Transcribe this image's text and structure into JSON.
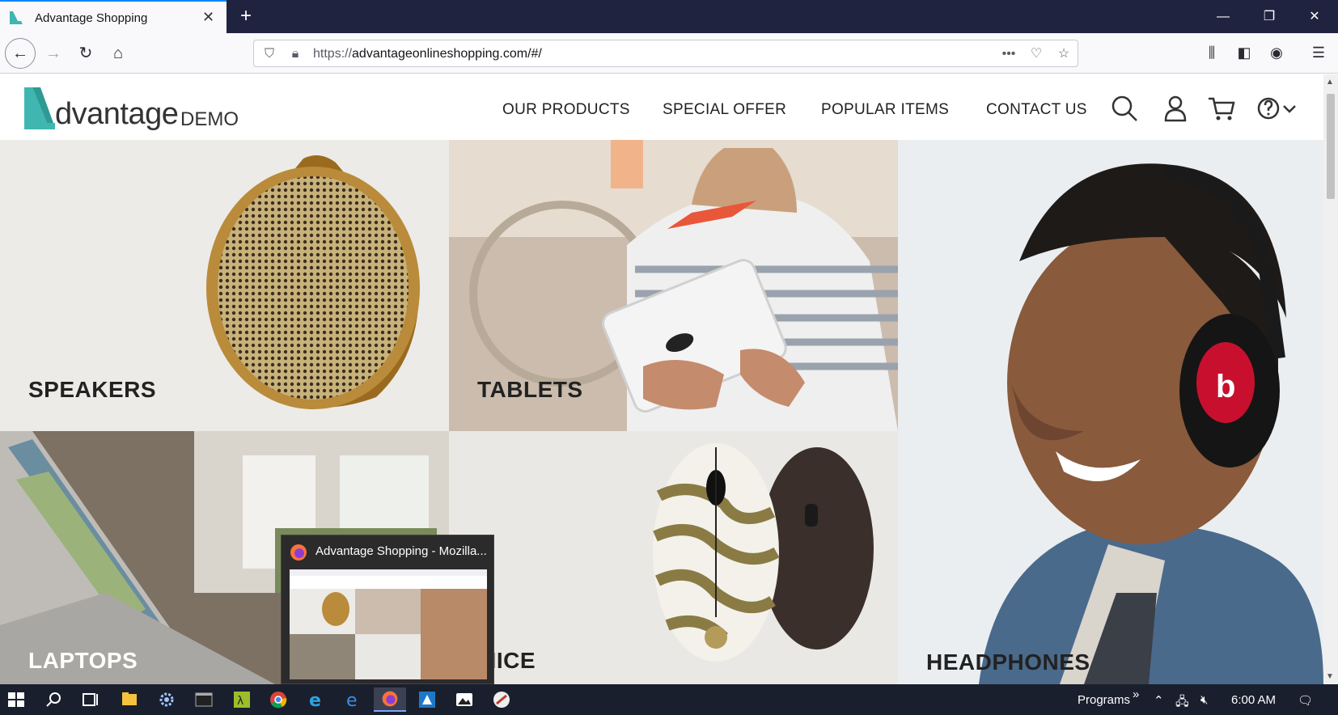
{
  "browser": {
    "tab_title": "Advantage Shopping",
    "url_scheme": "https://",
    "url_rest": "advantageonlineshopping.com/#/",
    "url_more": "•••"
  },
  "site": {
    "logo_word": "dvantage",
    "logo_demo": "DEMO",
    "menu": [
      "OUR PRODUCTS",
      "SPECIAL OFFER",
      "POPULAR ITEMS",
      "CONTACT US"
    ]
  },
  "categories": {
    "speakers": "SPEAKERS",
    "tablets": "TABLETS",
    "headphones": "HEADPHONES",
    "laptops": "LAPTOPS",
    "mice": "MICE"
  },
  "preview": {
    "title": "Advantage Shopping - Mozilla..."
  },
  "taskbar": {
    "programs_label": "Programs",
    "chevron": "»",
    "clock": "6:00 AM"
  },
  "colors": {
    "accent": "#0a84ff",
    "logo_teal": "#3fb7b0",
    "tabstrip": "#202340",
    "taskbar": "#1a1f2e"
  }
}
